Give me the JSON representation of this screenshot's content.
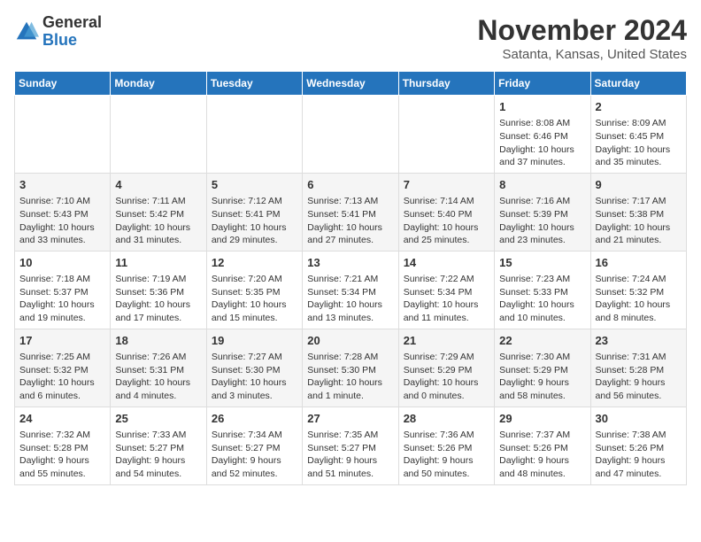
{
  "header": {
    "logo_line1": "General",
    "logo_line2": "Blue",
    "month_title": "November 2024",
    "location": "Satanta, Kansas, United States"
  },
  "weekdays": [
    "Sunday",
    "Monday",
    "Tuesday",
    "Wednesday",
    "Thursday",
    "Friday",
    "Saturday"
  ],
  "weeks": [
    [
      {
        "day": "",
        "info": ""
      },
      {
        "day": "",
        "info": ""
      },
      {
        "day": "",
        "info": ""
      },
      {
        "day": "",
        "info": ""
      },
      {
        "day": "",
        "info": ""
      },
      {
        "day": "1",
        "info": "Sunrise: 8:08 AM\nSunset: 6:46 PM\nDaylight: 10 hours and 37 minutes."
      },
      {
        "day": "2",
        "info": "Sunrise: 8:09 AM\nSunset: 6:45 PM\nDaylight: 10 hours and 35 minutes."
      }
    ],
    [
      {
        "day": "3",
        "info": "Sunrise: 7:10 AM\nSunset: 5:43 PM\nDaylight: 10 hours and 33 minutes."
      },
      {
        "day": "4",
        "info": "Sunrise: 7:11 AM\nSunset: 5:42 PM\nDaylight: 10 hours and 31 minutes."
      },
      {
        "day": "5",
        "info": "Sunrise: 7:12 AM\nSunset: 5:41 PM\nDaylight: 10 hours and 29 minutes."
      },
      {
        "day": "6",
        "info": "Sunrise: 7:13 AM\nSunset: 5:41 PM\nDaylight: 10 hours and 27 minutes."
      },
      {
        "day": "7",
        "info": "Sunrise: 7:14 AM\nSunset: 5:40 PM\nDaylight: 10 hours and 25 minutes."
      },
      {
        "day": "8",
        "info": "Sunrise: 7:16 AM\nSunset: 5:39 PM\nDaylight: 10 hours and 23 minutes."
      },
      {
        "day": "9",
        "info": "Sunrise: 7:17 AM\nSunset: 5:38 PM\nDaylight: 10 hours and 21 minutes."
      }
    ],
    [
      {
        "day": "10",
        "info": "Sunrise: 7:18 AM\nSunset: 5:37 PM\nDaylight: 10 hours and 19 minutes."
      },
      {
        "day": "11",
        "info": "Sunrise: 7:19 AM\nSunset: 5:36 PM\nDaylight: 10 hours and 17 minutes."
      },
      {
        "day": "12",
        "info": "Sunrise: 7:20 AM\nSunset: 5:35 PM\nDaylight: 10 hours and 15 minutes."
      },
      {
        "day": "13",
        "info": "Sunrise: 7:21 AM\nSunset: 5:34 PM\nDaylight: 10 hours and 13 minutes."
      },
      {
        "day": "14",
        "info": "Sunrise: 7:22 AM\nSunset: 5:34 PM\nDaylight: 10 hours and 11 minutes."
      },
      {
        "day": "15",
        "info": "Sunrise: 7:23 AM\nSunset: 5:33 PM\nDaylight: 10 hours and 10 minutes."
      },
      {
        "day": "16",
        "info": "Sunrise: 7:24 AM\nSunset: 5:32 PM\nDaylight: 10 hours and 8 minutes."
      }
    ],
    [
      {
        "day": "17",
        "info": "Sunrise: 7:25 AM\nSunset: 5:32 PM\nDaylight: 10 hours and 6 minutes."
      },
      {
        "day": "18",
        "info": "Sunrise: 7:26 AM\nSunset: 5:31 PM\nDaylight: 10 hours and 4 minutes."
      },
      {
        "day": "19",
        "info": "Sunrise: 7:27 AM\nSunset: 5:30 PM\nDaylight: 10 hours and 3 minutes."
      },
      {
        "day": "20",
        "info": "Sunrise: 7:28 AM\nSunset: 5:30 PM\nDaylight: 10 hours and 1 minute."
      },
      {
        "day": "21",
        "info": "Sunrise: 7:29 AM\nSunset: 5:29 PM\nDaylight: 10 hours and 0 minutes."
      },
      {
        "day": "22",
        "info": "Sunrise: 7:30 AM\nSunset: 5:29 PM\nDaylight: 9 hours and 58 minutes."
      },
      {
        "day": "23",
        "info": "Sunrise: 7:31 AM\nSunset: 5:28 PM\nDaylight: 9 hours and 56 minutes."
      }
    ],
    [
      {
        "day": "24",
        "info": "Sunrise: 7:32 AM\nSunset: 5:28 PM\nDaylight: 9 hours and 55 minutes."
      },
      {
        "day": "25",
        "info": "Sunrise: 7:33 AM\nSunset: 5:27 PM\nDaylight: 9 hours and 54 minutes."
      },
      {
        "day": "26",
        "info": "Sunrise: 7:34 AM\nSunset: 5:27 PM\nDaylight: 9 hours and 52 minutes."
      },
      {
        "day": "27",
        "info": "Sunrise: 7:35 AM\nSunset: 5:27 PM\nDaylight: 9 hours and 51 minutes."
      },
      {
        "day": "28",
        "info": "Sunrise: 7:36 AM\nSunset: 5:26 PM\nDaylight: 9 hours and 50 minutes."
      },
      {
        "day": "29",
        "info": "Sunrise: 7:37 AM\nSunset: 5:26 PM\nDaylight: 9 hours and 48 minutes."
      },
      {
        "day": "30",
        "info": "Sunrise: 7:38 AM\nSunset: 5:26 PM\nDaylight: 9 hours and 47 minutes."
      }
    ]
  ]
}
